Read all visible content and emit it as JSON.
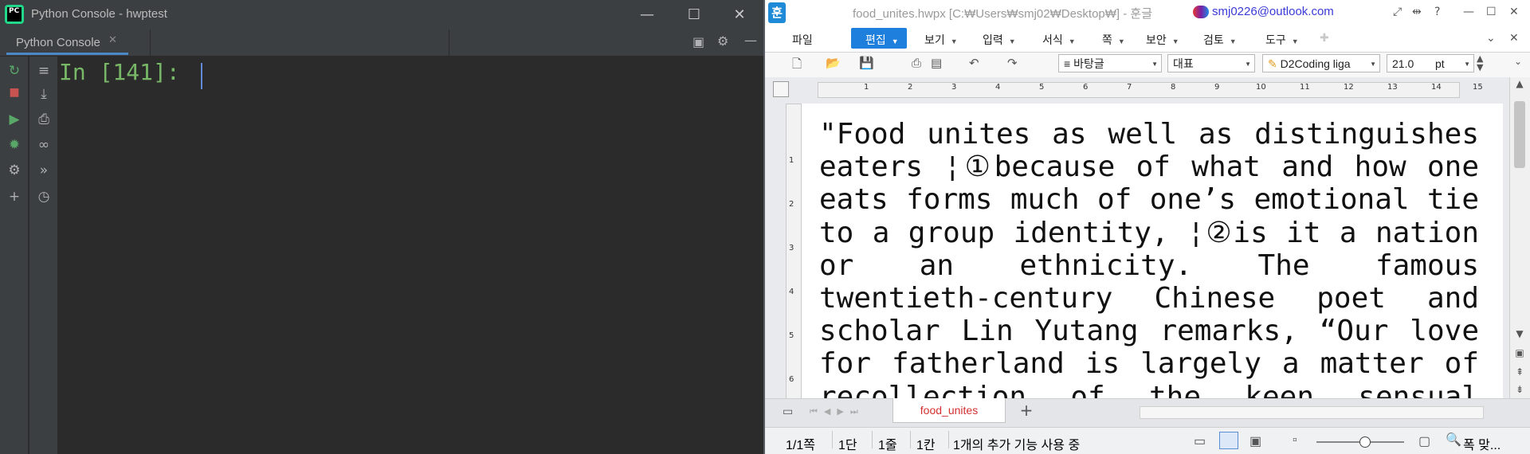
{
  "pycharm": {
    "window_title": "Python Console - hwptest",
    "console_tab": "Python Console",
    "tab_close": "✕",
    "prompt": "In [141]:",
    "logo_text": "PC"
  },
  "hwp": {
    "window_title": "food_unites.hwpx [C:₩Users₩smj02₩Desktop₩] - 훈글",
    "account": "smj0226@outlook.com",
    "logo_text": "훈",
    "menus": [
      "파일",
      "편집",
      "보기",
      "입력",
      "서식",
      "쪽",
      "보안",
      "검토",
      "도구"
    ],
    "active_menu": "편집",
    "style_combo": "바탕글",
    "lang_combo": "대표",
    "font_combo": "D2Coding liga",
    "size_value": "21.0",
    "size_unit": "pt",
    "ruler_numbers": [
      "1",
      "2",
      "3",
      "4",
      "5",
      "6",
      "7",
      "8",
      "9",
      "10",
      "11",
      "12",
      "13",
      "14",
      "15"
    ],
    "vruler_numbers": [
      "1",
      "2",
      "3",
      "4",
      "5",
      "6"
    ],
    "document_lines": [
      "\"Food unites as well as distinguishes",
      "eaters ¦①because of what and how one",
      "eats forms much of one’s emotional tie",
      "to a group identity, ¦②is it a nation",
      "or an ethnicity. The famous",
      "twentieth-century Chinese poet and",
      "scholar Lin Yutang remarks, “Our love",
      "for fatherland is largely a matter of",
      "recollection of the keen sensual"
    ],
    "sheet_tab": "food_unites",
    "add_tab": "+",
    "status": {
      "page": "1/1쪽",
      "section": "1단",
      "line": "1줄",
      "column": "1칸",
      "extra": "1개의 추가 기능 사용 중",
      "zoom_label": "폭 맞..."
    }
  }
}
